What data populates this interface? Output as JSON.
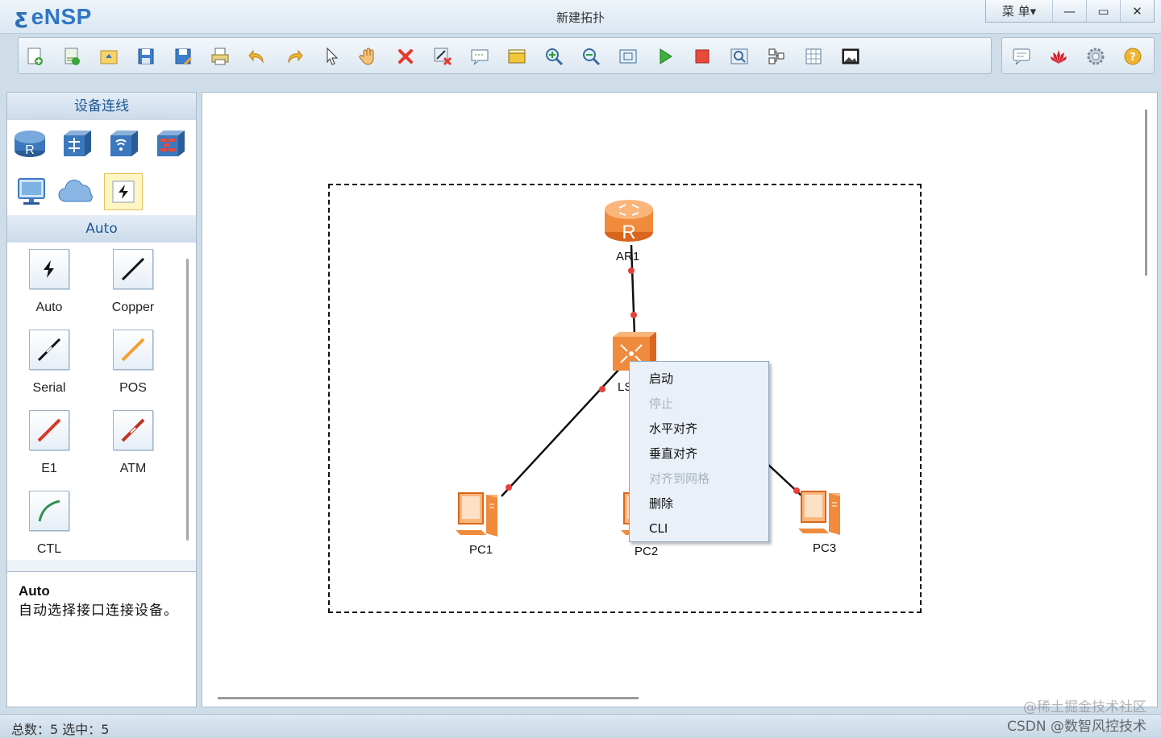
{
  "app": {
    "logo_text": "eNSP",
    "window_title": "新建拓扑",
    "menu_label": "菜 单▾",
    "min_symbol": "—",
    "max_symbol": "▭",
    "close_symbol": "✕"
  },
  "toolbar": {
    "buttons": [
      "new-topology",
      "new-exam",
      "open",
      "save",
      "save-as",
      "print",
      "undo",
      "redo",
      "select",
      "pan",
      "delete",
      "delete-link",
      "text",
      "palette",
      "zoom-in",
      "zoom-out",
      "fit",
      "start-all",
      "stop-all",
      "capture",
      "show-ports",
      "grid",
      "topology-screenshot"
    ],
    "right_buttons": [
      "chat",
      "huawei",
      "settings",
      "help"
    ]
  },
  "left_panel": {
    "device_header": "设备连线",
    "devices": [
      "router-icon",
      "switch-icon",
      "wireless-icon",
      "firewall-icon",
      "pc-icon",
      "cloud-icon",
      "connection-icon"
    ],
    "cable_header": "Auto",
    "cables": [
      {
        "label": "Auto",
        "color": "#111111"
      },
      {
        "label": "Copper",
        "color": "#111111"
      },
      {
        "label": "Serial",
        "color": "#111111"
      },
      {
        "label": "POS",
        "color": "#f5a030"
      },
      {
        "label": "E1",
        "color": "#d8382a"
      },
      {
        "label": "ATM",
        "color": "#c23022"
      },
      {
        "label": "CTL",
        "color": "#2f8f55"
      }
    ],
    "desc_title": "Auto",
    "desc_text": "自动选择接口连接设备。"
  },
  "topology": {
    "nodes": {
      "ar1": "AR1",
      "lsw": "LS",
      "pc1": "PC1",
      "pc2": "PC2",
      "pc3": "PC3"
    },
    "accent_orange": "#f08a3c",
    "port_color": "#e8403a"
  },
  "context_menu": {
    "items": [
      {
        "label": "启动",
        "enabled": true
      },
      {
        "label": "停止",
        "enabled": false
      },
      {
        "label": "水平对齐",
        "enabled": true
      },
      {
        "label": "垂直对齐",
        "enabled": true
      },
      {
        "label": "对齐到网格",
        "enabled": false
      },
      {
        "label": "删除",
        "enabled": true
      },
      {
        "label": "CLI",
        "enabled": true
      }
    ]
  },
  "status": {
    "text": "总数：5  选中：5"
  },
  "watermark": {
    "line1": "@稀土掘金技术社区",
    "line2": "CSDN @数智风控技术"
  }
}
